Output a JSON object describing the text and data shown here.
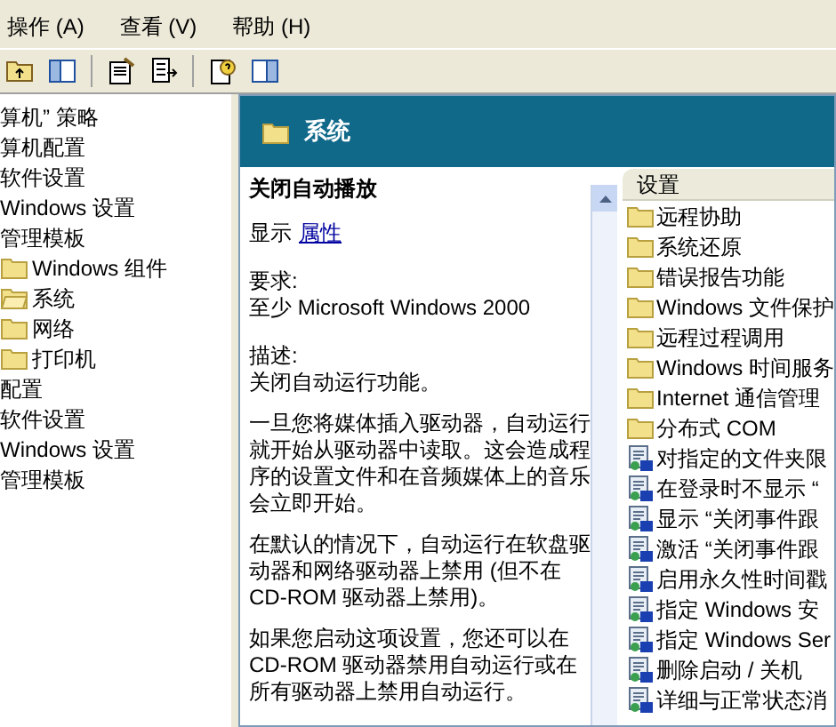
{
  "menu": [
    {
      "label": "操作 (A)"
    },
    {
      "label": "查看 (V)"
    },
    {
      "label": "帮助 (H)"
    }
  ],
  "tree": [
    {
      "label": "算机” 策略",
      "children": [
        {
          "label": "算机配置",
          "children": [
            {
              "label": "软件设置"
            },
            {
              "label": "Windows 设置"
            },
            {
              "label": "管理模板",
              "children": [
                {
                  "label": "Windows 组件",
                  "kind": "folder"
                },
                {
                  "label": "系统",
                  "kind": "open-folder"
                },
                {
                  "label": "网络",
                  "kind": "folder"
                },
                {
                  "label": "打印机",
                  "kind": "folder"
                }
              ]
            }
          ]
        },
        {
          "label": "配置",
          "children": [
            {
              "label": "软件设置"
            },
            {
              "label": "Windows 设置"
            },
            {
              "label": "管理模板"
            }
          ]
        }
      ]
    }
  ],
  "header": {
    "title": "系统"
  },
  "detail": {
    "title": "关闭自动播放",
    "show_label": "显示",
    "show_link": "属性",
    "requirements_label": "要求:",
    "requirements": "至少 Microsoft Windows 2000",
    "description_label": "描述:",
    "paragraphs": [
      "关闭自动运行功能。",
      "一旦您将媒体插入驱动器，自动运行就开始从驱动器中读取。这会造成程序的设置文件和在音频媒体上的音乐会立即开始。",
      "在默认的情况下，自动运行在软盘驱动器和网络驱动器上禁用 (但不在 CD-ROM 驱动器上禁用)。",
      "如果您启动这项设置，您还可以在 CD-ROM 驱动器禁用自动运行或在所有驱动器上禁用自动运行。"
    ]
  },
  "list": {
    "column": "设置",
    "items": [
      {
        "label": "远程协助",
        "kind": "folder"
      },
      {
        "label": "系统还原",
        "kind": "folder"
      },
      {
        "label": "错误报告功能",
        "kind": "folder"
      },
      {
        "label": "Windows 文件保护",
        "kind": "folder"
      },
      {
        "label": "远程过程调用",
        "kind": "folder"
      },
      {
        "label": "Windows 时间服务",
        "kind": "folder"
      },
      {
        "label": "Internet 通信管理",
        "kind": "folder"
      },
      {
        "label": "分布式 COM",
        "kind": "folder"
      },
      {
        "label": "对指定的文件夹限",
        "kind": "policy"
      },
      {
        "label": "在登录时不显示 “",
        "kind": "policy"
      },
      {
        "label": "显示 “关闭事件跟",
        "kind": "policy"
      },
      {
        "label": "激活 “关闭事件跟",
        "kind": "policy"
      },
      {
        "label": "启用永久性时间戳",
        "kind": "policy"
      },
      {
        "label": "指定 Windows 安",
        "kind": "policy"
      },
      {
        "label": "指定 Windows Ser",
        "kind": "policy"
      },
      {
        "label": "删除启动 / 关机",
        "kind": "policy"
      },
      {
        "label": "详细与正常状态消",
        "kind": "policy"
      }
    ]
  }
}
